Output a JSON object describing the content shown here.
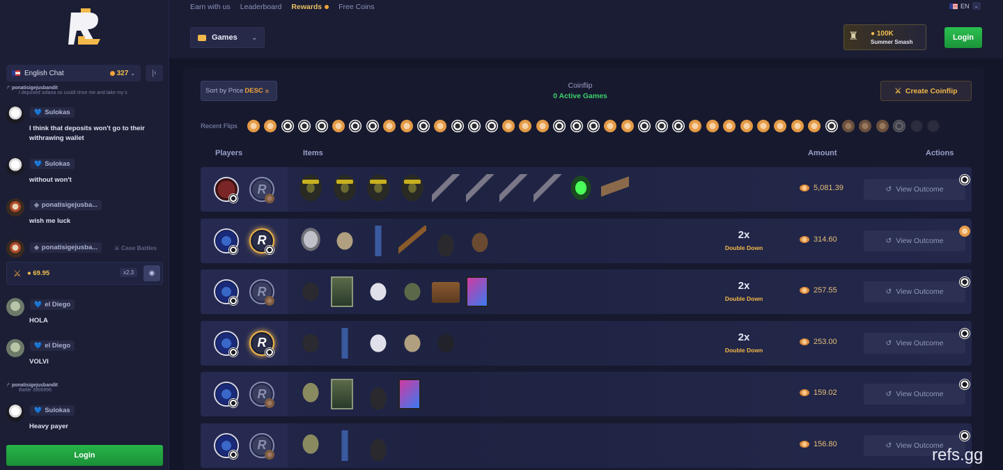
{
  "nav": {
    "links": [
      "Earn with us",
      "Leaderboard",
      "Rewards",
      "Free Coins"
    ],
    "language": "EN",
    "games_label": "Games",
    "promo_amount": "100K",
    "promo_name": "Summer Smash",
    "login_label": "Login"
  },
  "chat": {
    "room": "English Chat",
    "online": "327",
    "messages": [
      {
        "reply_user": "ponatisigejusbandit",
        "reply_text": "I deposed solana so could rinse me and take my s"
      },
      {
        "user": "Sulokas",
        "text": "I think that deposits won't go to their withrawing wallet"
      },
      {
        "user": "Sulokas",
        "text": "without won't"
      },
      {
        "user": "ponatisigejusba...",
        "text": "wish me luck"
      },
      {
        "user": "ponatisigejusba...",
        "tag": "Case Battles",
        "amount": "69.95",
        "mult": "x2.3"
      },
      {
        "user": "el Diego",
        "text": "HOLA"
      },
      {
        "user": "el Diego",
        "text": "VOLVI"
      },
      {
        "reply_user": "ponatisigejusbandit",
        "reply_text": "Battle 3906996"
      },
      {
        "user": "Sulokas",
        "text": "Heavy payer"
      }
    ],
    "login_label": "Login"
  },
  "coinflip": {
    "sort_label": "Sort by Price",
    "sort_dir": "DESC",
    "title": "Coinflip",
    "active": "0 Active Games",
    "create_label": "Create Coinflip",
    "recent_label": "Recent Flips",
    "recent": [
      "coin",
      "coin",
      "chip",
      "chip",
      "chip",
      "coin",
      "chip",
      "chip",
      "coin",
      "coin",
      "chip",
      "coin",
      "chip",
      "chip",
      "chip",
      "coin",
      "coin",
      "coin",
      "chip",
      "chip",
      "chip",
      "coin",
      "coin",
      "chip",
      "chip",
      "chip",
      "coin",
      "coin",
      "coin",
      "coin",
      "coin",
      "coin",
      "coin",
      "coin",
      "chip",
      "fcoin",
      "fcoin",
      "fcoin",
      "fchip",
      "ghost",
      "ghost"
    ],
    "headers": {
      "players": "Players",
      "items": "Items",
      "amount": "Amount",
      "actions": "Actions"
    },
    "view_label": "View Outcome",
    "games": [
      {
        "p1": "red",
        "p2": "bot",
        "p2win": false,
        "mult": "",
        "mult_sub": "",
        "amount": "5,081.39",
        "side": "chip",
        "items": [
          "helmet",
          "helmet",
          "helmet",
          "helmet",
          "rifle",
          "rifle",
          "rifle",
          "rifle",
          "mask",
          "pistol"
        ]
      },
      {
        "p1": "blue",
        "p2": "bot",
        "p2win": true,
        "mult": "2x",
        "mult_sub": "Double Down",
        "amount": "314.60",
        "side": "coin",
        "items": [
          "facemask",
          "vest",
          "suit",
          "xbow",
          "boots",
          "hat"
        ]
      },
      {
        "p1": "blue",
        "p2": "bot",
        "p2win": false,
        "mult": "2x",
        "mult_sub": "Double Down",
        "amount": "257.55",
        "side": "chip",
        "items": [
          "armor",
          "slot",
          "helm2",
          "jacket",
          "crate",
          "neon"
        ]
      },
      {
        "p1": "blue",
        "p2": "bot",
        "p2win": true,
        "mult": "2x",
        "mult_sub": "Double Down",
        "amount": "253.00",
        "side": "chip",
        "items": [
          "armor",
          "suit",
          "helm2",
          "vest",
          "coat"
        ]
      },
      {
        "p1": "blue",
        "p2": "bot",
        "p2win": false,
        "mult": "",
        "mult_sub": "",
        "amount": "159.02",
        "side": "chip",
        "items": [
          "hood",
          "slot",
          "boots",
          "neon"
        ]
      },
      {
        "p1": "blue",
        "p2": "bot",
        "p2win": false,
        "mult": "",
        "mult_sub": "",
        "amount": "156.80",
        "side": "chip",
        "items": [
          "hood",
          "suit",
          "boots"
        ]
      }
    ]
  },
  "watermark": "refs.gg"
}
